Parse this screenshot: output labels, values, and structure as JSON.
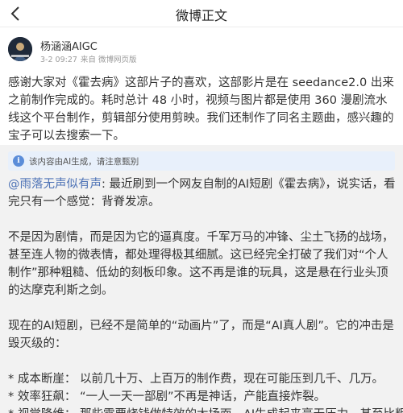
{
  "nav": {
    "title": "微博正文"
  },
  "author": {
    "name": "杨涵涵AIGC",
    "date": "3-2 09:27",
    "source": "来自 微博网页版"
  },
  "post": {
    "text": "感谢大家对《霍去病》这部片子的喜欢，这部影片是在 seedance2.0 出来之前制作完成的。耗时总计 48 小时，视频与图片都是使用 360 漫剧流水线这个平台制作，剪辑部分使用剪映。我们还制作了同名主题曲，感兴趣的宝子可以去搜索一下。"
  },
  "repost": {
    "ai_note": "该内容由AI生成，请注意甄别",
    "mention": "@雨落无声似有声",
    "intro": ": 最近刷到一个网友自制的AI短剧《霍去病》，说实话，看完只有一个感觉：背脊发凉。",
    "para1": "不是因为剧情，而是因为它的逼真度。千军万马的冲锋、尘土飞扬的战场，甚至连人物的微表情，都处理得极其细腻。这已经完全打破了我们对“个人制作”那种粗糙、低幼的刻板印象。这不再是谁的玩具，这是悬在行业头顶的达摩克利斯之剑。",
    "para2": "现在的AI短剧，已经不是简单的“动画片”了，而是“AI真人剧”。它的冲击是毁灭级的：",
    "bullets": [
      "* 成本断崖： 以前几十万、上百万的制作费，现在可能压到几千、几万。",
      "* 效率狂飙： “一人一天一部剧”不再是神话，产能直接炸裂。",
      "* 视觉降维： 那些需要烧钱做特效的大场面，AI生成起来毫无压力，甚至比粗糙"
    ]
  },
  "colors": {
    "mention": "#4e73b6",
    "repost_bg": "#f2f2f2",
    "note_bg": "#e8f0fb",
    "info_icon": "#5b8dd9"
  },
  "icons": {
    "back": "chevron-left-icon",
    "info": "info-icon"
  }
}
